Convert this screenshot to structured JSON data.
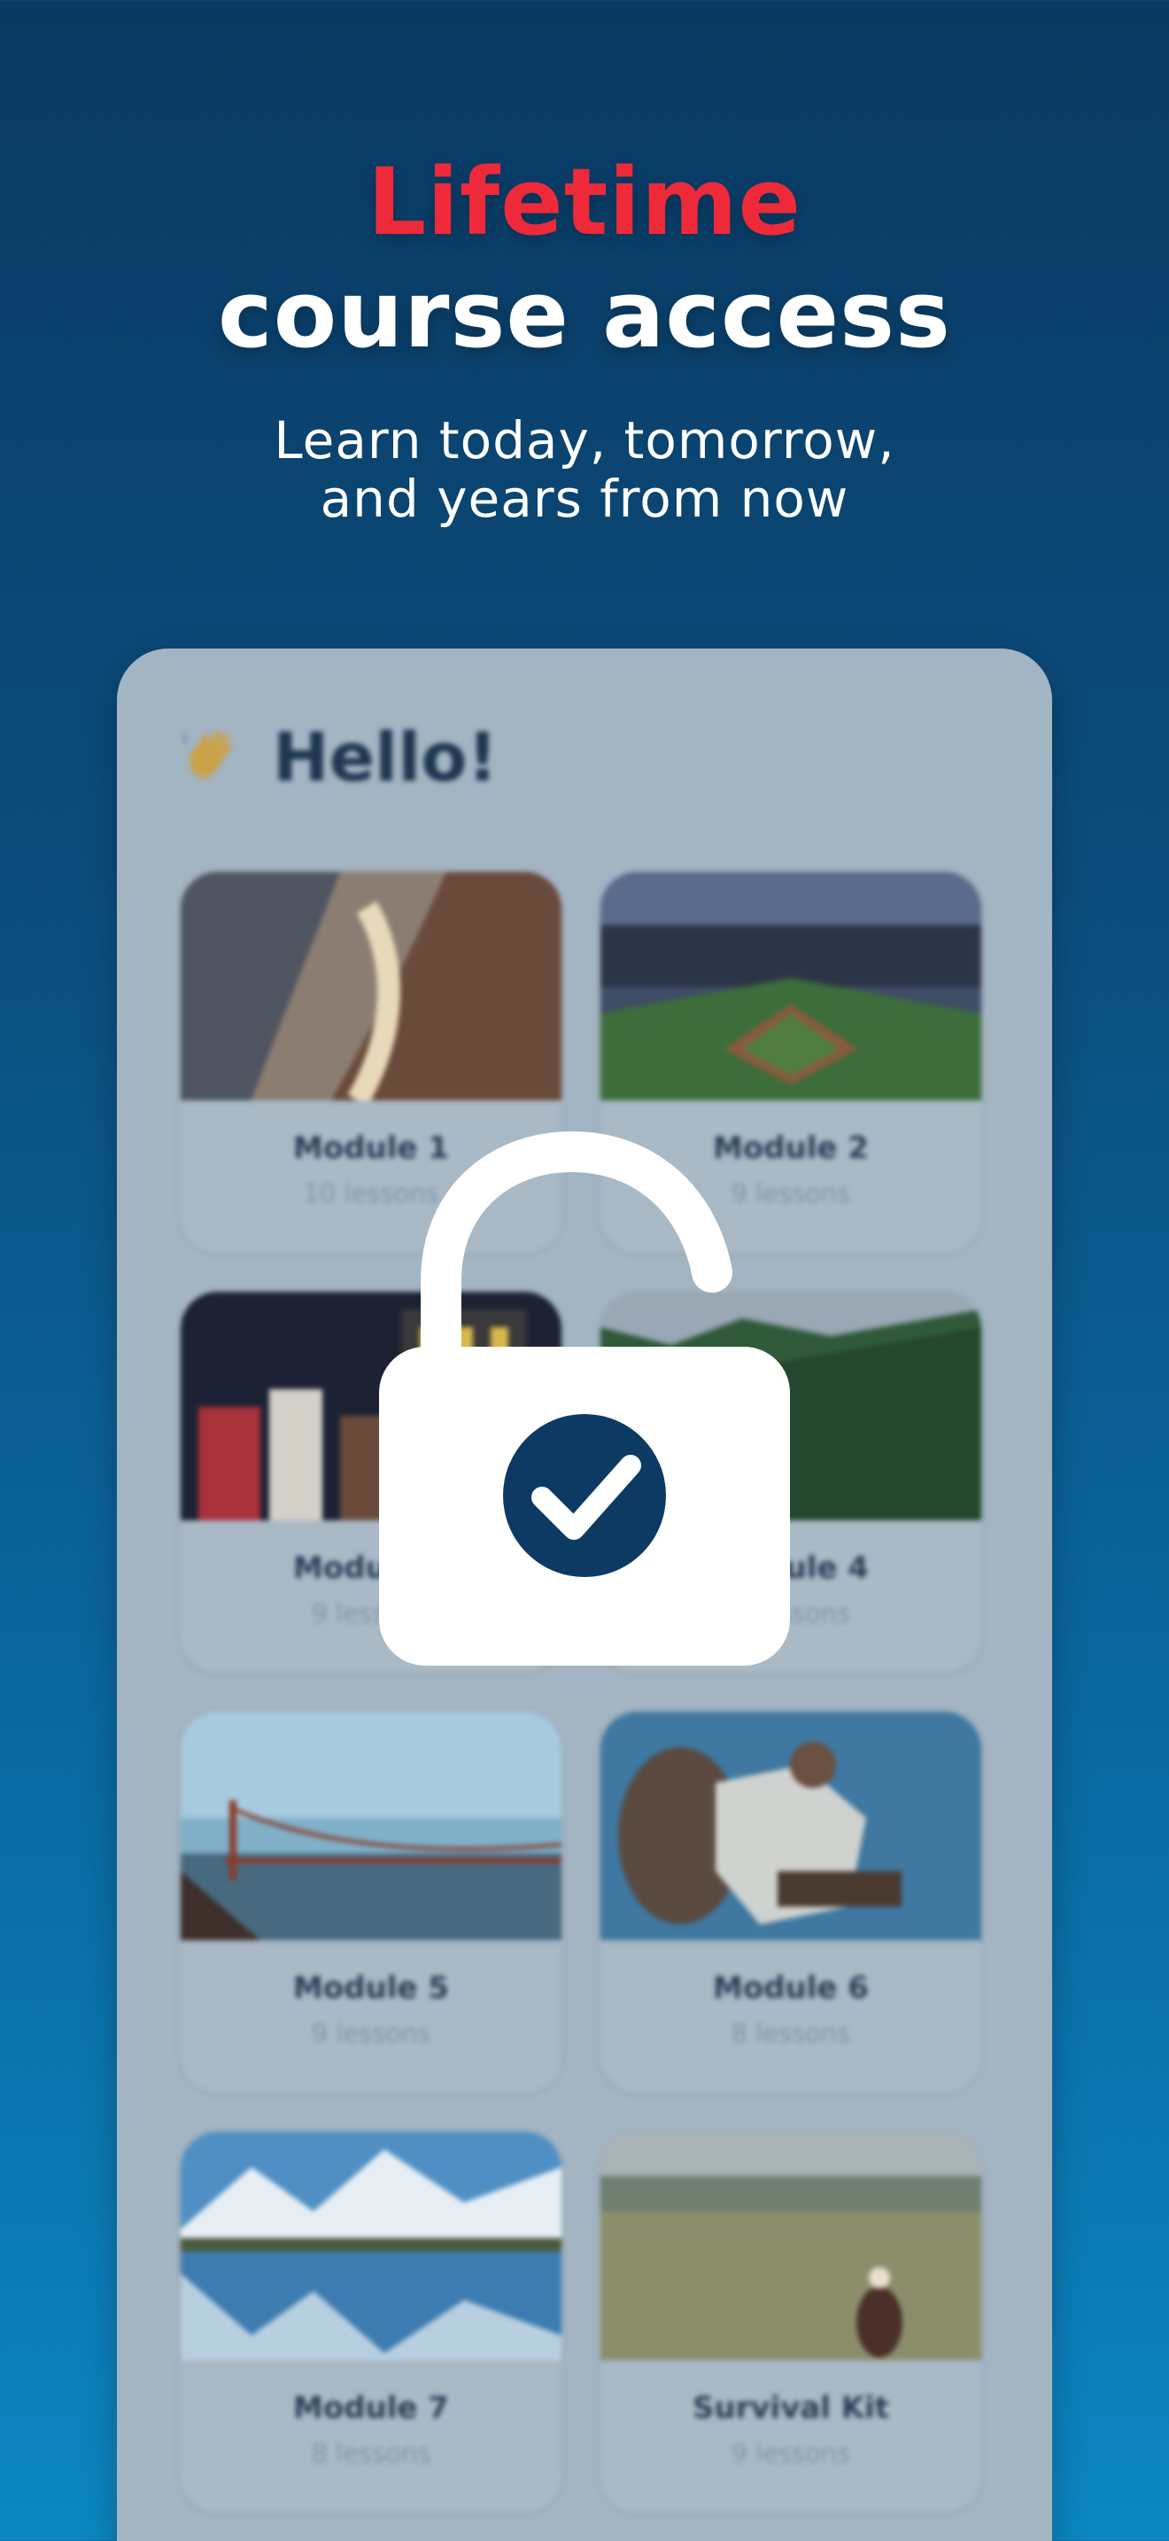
{
  "headline": {
    "line1": "Lifetime",
    "line2": "course access",
    "subtitle_line1": "Learn today, tomorrow,",
    "subtitle_line2": "and years from now"
  },
  "colors": {
    "accent_red": "#ee2a3a",
    "lock_white": "#ffffff",
    "check_navy": "#0c3a63"
  },
  "mockup": {
    "greeting_icon": "waving-hand-icon",
    "greeting": "Hello!",
    "modules": [
      {
        "title": "Module 1",
        "lessons": "10 lessons",
        "photo": "canyon"
      },
      {
        "title": "Module 2",
        "lessons": "9 lessons",
        "photo": "baseball-stadium"
      },
      {
        "title": "Module 3",
        "lessons": "9 lessons",
        "photo": "parade-night"
      },
      {
        "title": "Module 4",
        "lessons": "9 lessons",
        "photo": "green-cliffs"
      },
      {
        "title": "Module 5",
        "lessons": "9 lessons",
        "photo": "golden-gate-bridge"
      },
      {
        "title": "Module 6",
        "lessons": "8 lessons",
        "photo": "headdress-dancer"
      },
      {
        "title": "Module 7",
        "lessons": "8 lessons",
        "photo": "mountain-lake-reflection"
      },
      {
        "title": "Survival Kit",
        "lessons": "9 lessons",
        "photo": "prairie-rider"
      }
    ]
  },
  "overlay": {
    "icon": "unlocked-padlock-check-icon"
  }
}
